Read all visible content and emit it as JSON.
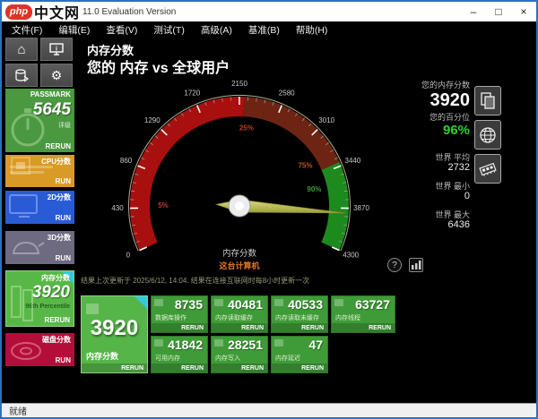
{
  "window": {
    "logo_php": "php",
    "logo_cn": "中文网",
    "title": "11.0 Evaluation Version",
    "controls": {
      "minimize": "–",
      "maximize": "□",
      "close": "×"
    }
  },
  "menu": {
    "items": [
      "文件(F)",
      "编辑(E)",
      "查看(V)",
      "测试(T)",
      "高级(A)",
      "基准(B)",
      "帮助(H)"
    ]
  },
  "sidebar": {
    "buttons": [
      "home",
      "system-info",
      "baselines",
      "settings"
    ],
    "tiles": [
      {
        "id": "passmark",
        "label": "PASSMARK",
        "value": "5645",
        "sub": "评级",
        "action": "RERUN",
        "color": "#4a9840",
        "selected": false
      },
      {
        "id": "cpu",
        "label": "CPU分数",
        "value": "",
        "sub": "",
        "action": "RUN",
        "color": "#d99b26",
        "selected": false
      },
      {
        "id": "2d",
        "label": "2D分数",
        "value": "",
        "sub": "",
        "action": "RUN",
        "color": "#2a5bd7",
        "selected": false
      },
      {
        "id": "3d",
        "label": "3D分数",
        "value": "",
        "sub": "",
        "action": "RUN",
        "color": "#6e6a80",
        "selected": false
      },
      {
        "id": "memory",
        "label": "内存分数",
        "value": "3920",
        "sub": "96th Percentile",
        "action": "RERUN",
        "color": "#58b847",
        "selected": true
      },
      {
        "id": "disk",
        "label": "磁盘分数",
        "value": "",
        "sub": "",
        "action": "RUN",
        "color": "#b50d3a",
        "selected": false
      }
    ]
  },
  "main": {
    "title": "内存分数",
    "subtitle": "您的 内存 vs 全球用户",
    "note": "结果上次更新于 2025/6/12, 14:04. 结果在连接互联网时每8小时更新一次",
    "gauge": {
      "type": "gauge",
      "min": 0,
      "max": 4300,
      "value": 3920,
      "start_angle": 156,
      "sweep": 228,
      "tick_step": 430,
      "minor_step": 86,
      "tick_labels": [
        "0",
        "430",
        "860",
        "1290",
        "1720",
        "2150",
        "2580",
        "3010",
        "3440",
        "3870",
        "4300"
      ],
      "segments": [
        {
          "from": 0,
          "to": 2200,
          "color": "#a81010"
        },
        {
          "from": 2200,
          "to": 3400,
          "color": "#6e2413"
        },
        {
          "from": 3400,
          "to": 4300,
          "color": "#1d8a1d"
        }
      ],
      "percent_markers": [
        {
          "label": "5%",
          "value": 430,
          "color": "#c23a2a"
        },
        {
          "label": "25%",
          "value": 2250,
          "color": "#c23a2a"
        },
        {
          "label": "75%",
          "value": 3280,
          "color": "#c05028"
        },
        {
          "label": "90%",
          "value": 3640,
          "color": "#3f9b37"
        }
      ],
      "center_label": "内存分数",
      "center_sublabel": "这台计算机",
      "needle_color_light": "#e8e890",
      "needle_color_dark": "#a8a838"
    },
    "stats": {
      "your_score_label": "您的内存分数",
      "your_score": "3920",
      "percentile_label": "您的百分位",
      "percentile": "96%",
      "world_avg_label": "世界 平均",
      "world_avg": "2732",
      "world_min_label": "世界 最小",
      "world_min": "0",
      "world_max_label": "世界 最大",
      "world_max": "6436"
    },
    "side_buttons": [
      "copy-results",
      "world-results",
      "memory-info"
    ],
    "gauge_tools": {
      "help": "?",
      "chart": "chart"
    }
  },
  "results": {
    "main_tile": {
      "value": "3920",
      "label": "内存分数",
      "action": "RERUN"
    },
    "tiles": [
      {
        "value": "8735",
        "label": "数据库操作",
        "action": "RERUN"
      },
      {
        "value": "40481",
        "label": "内存读取缓存",
        "action": "RERUN"
      },
      {
        "value": "40533",
        "label": "内存读取未缓存",
        "action": "RERUN"
      },
      {
        "value": "63727",
        "label": "内存线程",
        "action": "RERUN"
      },
      {
        "value": "41842",
        "label": "可用内存",
        "action": "RERUN"
      },
      {
        "value": "28251",
        "label": "内存写入",
        "action": "RERUN"
      },
      {
        "value": "47",
        "label": "内存延迟",
        "action": "RERUN"
      }
    ]
  },
  "statusbar": {
    "text": "就绪"
  }
}
